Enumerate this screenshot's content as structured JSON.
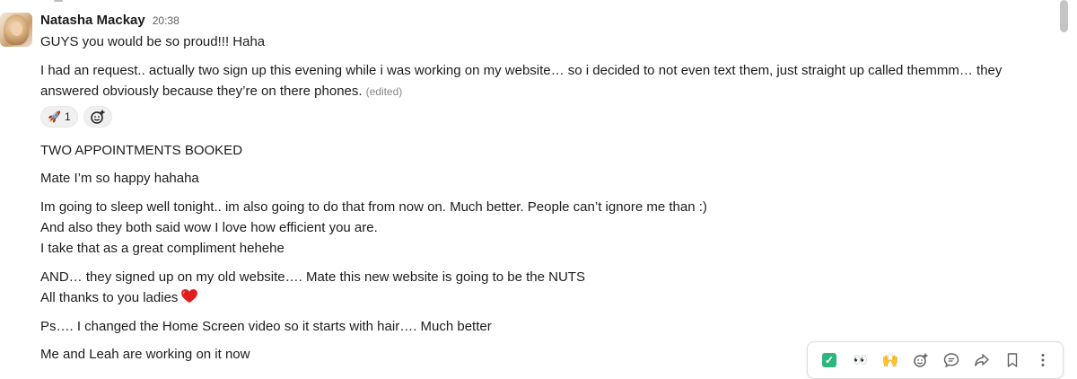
{
  "message": {
    "author": "Natasha Mackay",
    "timestamp": "20:38",
    "lines": [
      "GUYS you would be so proud!!! Haha",
      "I had an request.. actually two sign up this evening while i was working on my website… so i decided to not even text them, just straight up called themmm… they",
      "answered obviously because they’re on there phones.",
      "TWO APPOINTMENTS BOOKED",
      "Mate I’m so happy hahaha",
      "Im going to sleep well tonight.. im also going to do that from now on. Much better. People can’t ignore me than :)",
      "And also they both said wow I love how efficient you are.",
      "I take that as a great compliment hehehe",
      "AND… they signed up on my old website…. Mate this new website is going to be the NUTS",
      "All thanks to you ladies",
      "Ps…. I changed the Home Screen video so it starts with hair…. Much better",
      "Me and Leah are working on it now"
    ],
    "edited_label": "(edited)"
  },
  "reactions": [
    {
      "emoji": "🚀",
      "icon": "rocket-icon",
      "count": "1"
    }
  ],
  "toolbar": {
    "items": [
      {
        "name": "complete-reaction",
        "icon": "check-mark-icon",
        "glyph": "✓"
      },
      {
        "name": "eyes-reaction",
        "icon": "eyes-icon",
        "glyph": "👀"
      },
      {
        "name": "raised-hands-reaction",
        "icon": "raised-hands-icon",
        "glyph": "🙌"
      },
      {
        "name": "add-reaction",
        "icon": "add-reaction-icon",
        "glyph": "☺"
      },
      {
        "name": "reply-in-thread",
        "icon": "reply-icon",
        "glyph": "💬"
      },
      {
        "name": "forward-message",
        "icon": "forward-icon",
        "glyph": "➦"
      },
      {
        "name": "save-for-later",
        "icon": "bookmark-icon",
        "glyph": "🔖"
      },
      {
        "name": "more-actions",
        "icon": "more-icon",
        "glyph": "⋮"
      }
    ]
  },
  "colors": {
    "text": "#1d1c1d",
    "muted": "#616061",
    "check": "#2eb67d",
    "heart": "#e01e1e"
  }
}
